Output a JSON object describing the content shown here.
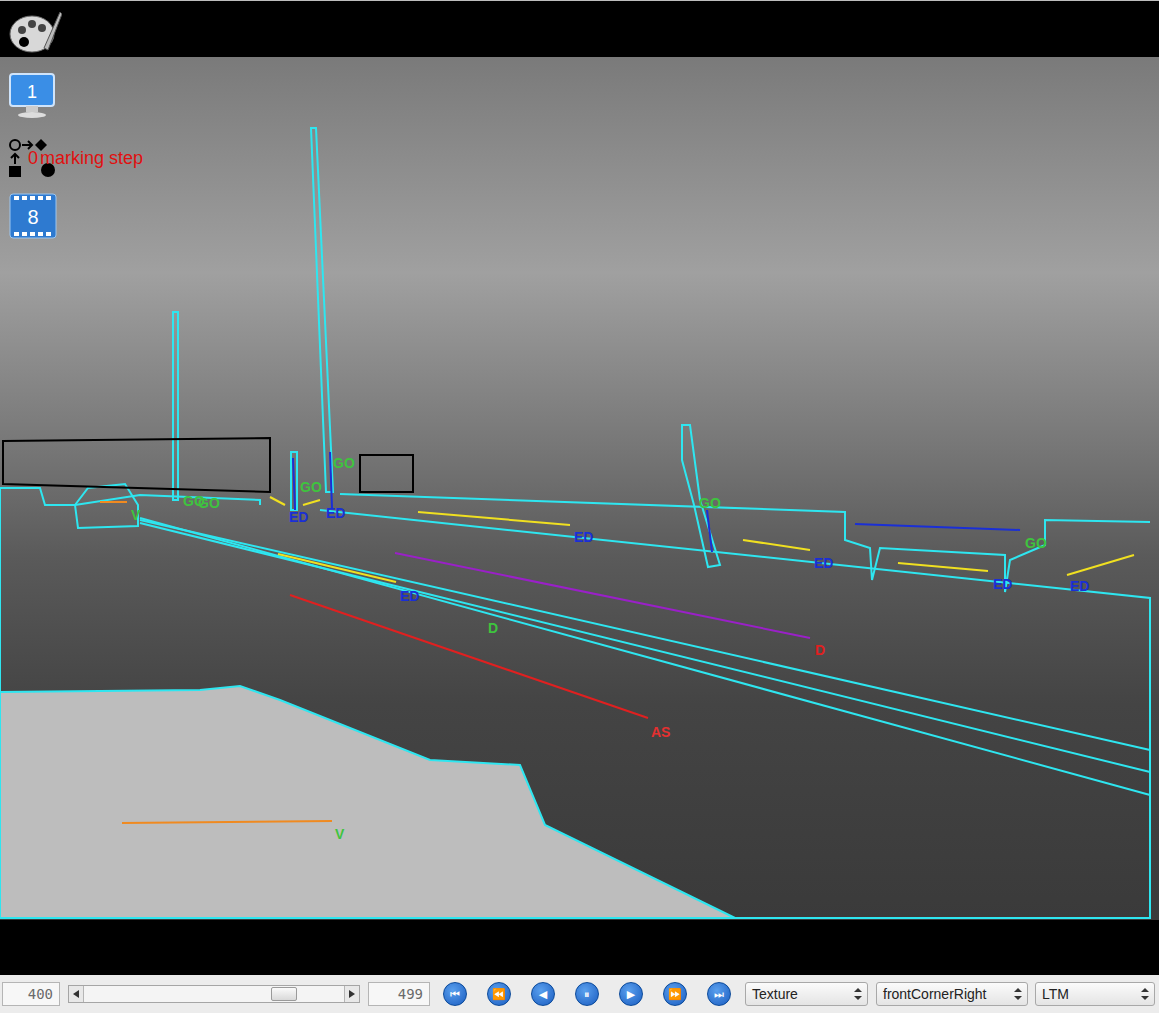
{
  "side_icons": {
    "monitor": "1",
    "marking": {
      "count": "0",
      "label": "marking step"
    },
    "film": "8"
  },
  "annotations": [
    {
      "label": "GO",
      "color": "#3ec43e"
    },
    {
      "label": "GO",
      "color": "#3ec43e"
    },
    {
      "label": "GO",
      "color": "#3ec43e"
    },
    {
      "label": "GO",
      "color": "#3ec43e"
    },
    {
      "label": "ED",
      "color": "#1a2fd6"
    },
    {
      "label": "ED",
      "color": "#1a2fd6"
    },
    {
      "label": "ED",
      "color": "#1a2fd6"
    },
    {
      "label": "GO",
      "color": "#3ec43e"
    },
    {
      "label": "ED",
      "color": "#1a2fd6"
    },
    {
      "label": "GO",
      "color": "#3ec43e"
    },
    {
      "label": "ED",
      "color": "#1a2fd6"
    },
    {
      "label": "ED",
      "color": "#1a2fd6"
    },
    {
      "label": "ED",
      "color": "#1a2fd6"
    },
    {
      "label": "D",
      "color": "#3ec43e"
    },
    {
      "label": "D",
      "color": "#e02020"
    },
    {
      "label": "AS",
      "color": "#e53030"
    },
    {
      "label": "V",
      "color": "#3ec43e"
    },
    {
      "label": "V",
      "color": "#3ec43e"
    }
  ],
  "toolbar": {
    "start_frame": "400",
    "end_frame": "499",
    "scrubber": {
      "level": 0.77
    },
    "buttons": [
      "⏮",
      "⏪",
      "◀",
      "⏸",
      "▶",
      "⏩",
      "⏭"
    ],
    "selects": [
      {
        "value": "Texture"
      },
      {
        "value": "frontCornerRight"
      },
      {
        "value": "LTM"
      }
    ]
  }
}
